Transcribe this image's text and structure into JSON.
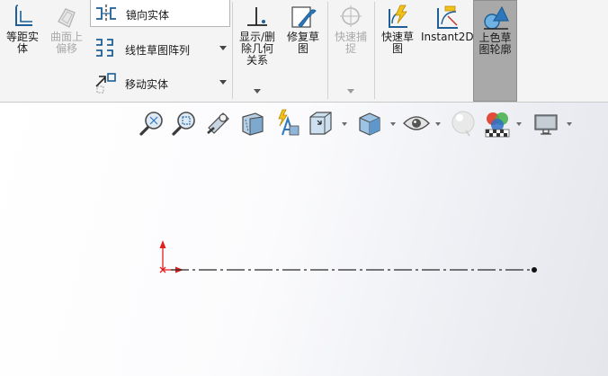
{
  "ribbon": {
    "offset_entities": {
      "label": "等距实\n体"
    },
    "offset_surface": {
      "label": "曲面上\n偏移"
    },
    "mirror_entities": {
      "label": "镜向实体"
    },
    "linear_pattern": {
      "label": "线性草图阵列"
    },
    "move_entities": {
      "label": "移动实体"
    },
    "display_delete_relations": {
      "label": "显示/删\n除几何\n关系"
    },
    "repair_sketch": {
      "label": "修复草\n图"
    },
    "quick_snaps": {
      "label": "快速捕\n捉"
    },
    "rapid_sketch": {
      "label": "快速草\n图"
    },
    "instant2d": {
      "label": "Instant2D"
    },
    "shaded_sketch_contours": {
      "label": "上色草\n图轮廓"
    }
  },
  "heads_up_toolbar": {
    "items": [
      "zoom-to-fit-icon",
      "zoom-to-area-icon",
      "previous-view-icon",
      "section-view-icon",
      "dynamic-annotation-views-icon",
      "view-orientation-icon",
      "display-style-icon",
      "hide-show-items-icon",
      "edit-appearance-icon",
      "apply-scene-icon",
      "view-settings-icon"
    ]
  },
  "colors": {
    "ribbon_bg": "#f4f4f4",
    "active_button_bg": "#a9a9a9",
    "origin_red": "#e0201f",
    "centerline": "#2a2a2a",
    "icon_blue": "#1d5f96"
  }
}
